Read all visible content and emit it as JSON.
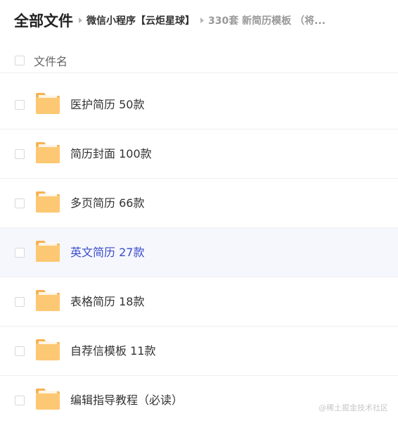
{
  "breadcrumb": {
    "root": "全部文件",
    "items": [
      "微信小程序【云炬星球】",
      "330套 新简历模板 （将..."
    ]
  },
  "list_header": {
    "name_label": "文件名"
  },
  "folder_icon": "folder-icon",
  "colors": {
    "folder": "#fdc873",
    "folder_tab": "#f6b253",
    "hover_bg": "#f5f7fd",
    "hover_text": "#3b4bc9"
  },
  "rows": [
    {
      "label": "医护简历 50款"
    },
    {
      "label": "简历封面 100款"
    },
    {
      "label": "多页简历 66款"
    },
    {
      "label": "英文简历 27款"
    },
    {
      "label": "表格简历 18款"
    },
    {
      "label": "自荐信模板 11款"
    },
    {
      "label": "编辑指导教程（必读）"
    }
  ],
  "watermark": "@稀土掘金技术社区"
}
